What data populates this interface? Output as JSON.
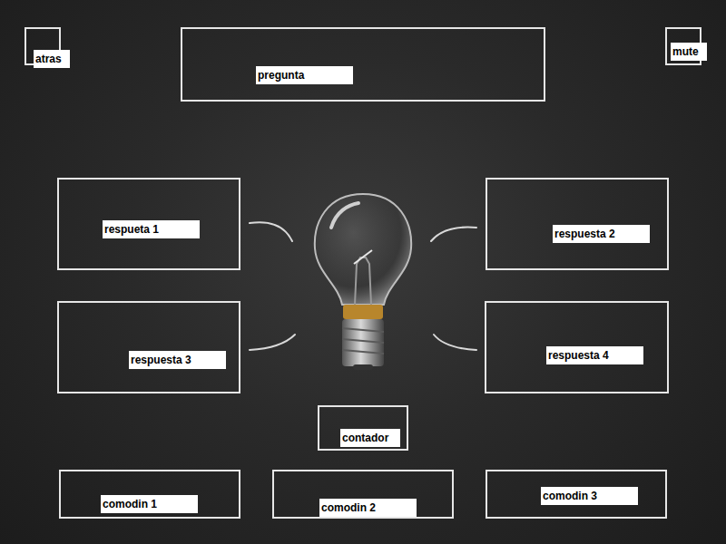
{
  "top": {
    "back": "atras",
    "mute": "mute"
  },
  "question": "pregunta",
  "answers": [
    "respueta 1",
    "respuesta 2",
    "respuesta 3",
    "respuesta 4"
  ],
  "counter": "contador",
  "jokers": [
    "comodin 1",
    "comodin 2",
    "comodin 3"
  ]
}
